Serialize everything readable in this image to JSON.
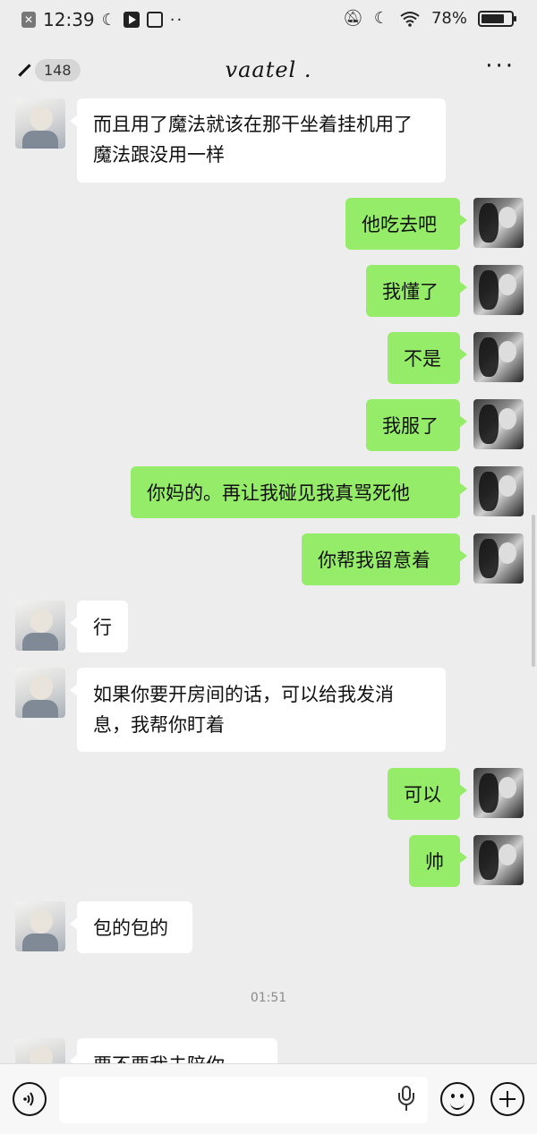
{
  "status_bar": {
    "time": "12:39",
    "battery": "78%",
    "battery_level": 0.78,
    "dots": "··"
  },
  "header": {
    "back_badge": "148",
    "title": "vaatel .",
    "more": "···"
  },
  "messages": [
    {
      "side": "left",
      "text": "而且用了魔法就该在那干坐着挂机用了魔法跟没用一样"
    },
    {
      "side": "right",
      "text": "他吃去吧"
    },
    {
      "side": "right",
      "text": "我懂了"
    },
    {
      "side": "right",
      "text": "不是"
    },
    {
      "side": "right",
      "text": "我服了"
    },
    {
      "side": "right",
      "text": "你妈的。再让我碰见我真骂死他"
    },
    {
      "side": "right",
      "text": "你帮我留意着"
    },
    {
      "side": "left",
      "text": "行"
    },
    {
      "side": "left",
      "text": "如果你要开房间的话，可以给我发消息，我帮你盯着"
    },
    {
      "side": "right",
      "text": "可以"
    },
    {
      "side": "right",
      "text": "帅"
    },
    {
      "side": "left",
      "text": "包的包的"
    },
    {
      "side": "time",
      "text": "01:51"
    },
    {
      "side": "left",
      "text": "要不要我去陪你"
    }
  ],
  "input": {
    "value": "",
    "placeholder": ""
  },
  "icons": {
    "voice": "voice-icon",
    "mic": "mic-icon",
    "emoji": "emoji-icon",
    "plus": "plus-icon"
  },
  "colors": {
    "background": "#ededed",
    "sent_bubble": "#95ec69",
    "received_bubble": "#ffffff"
  }
}
